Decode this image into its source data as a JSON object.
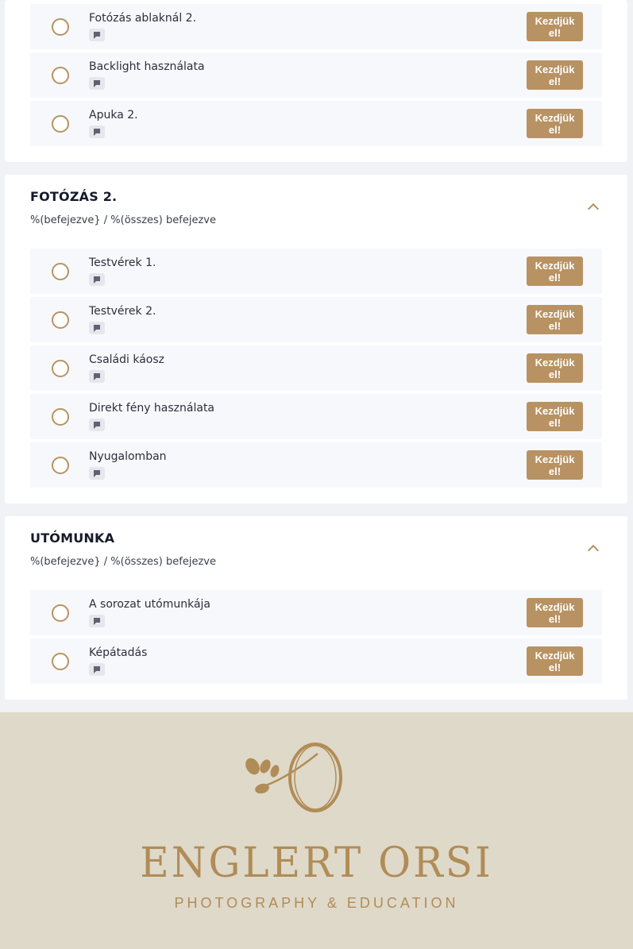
{
  "start_label": "Kezdjük el!",
  "progress_text": "%(befejezve} / %(összes) befejezve",
  "sections": [
    {
      "title": "",
      "lessons": [
        {
          "title": "Fotózás ablaknál 2."
        },
        {
          "title": "Backlight használata"
        },
        {
          "title": "Apuka 2."
        }
      ]
    },
    {
      "title": "FOTÓZÁS 2.",
      "lessons": [
        {
          "title": "Testvérek 1."
        },
        {
          "title": "Testvérek 2."
        },
        {
          "title": "Családi káosz"
        },
        {
          "title": "Direkt fény használata"
        },
        {
          "title": "Nyugalomban"
        }
      ]
    },
    {
      "title": "UTÓMUNKA",
      "lessons": [
        {
          "title": "A sorozat utómunkája"
        },
        {
          "title": "Képátadás"
        }
      ]
    }
  ],
  "footer": {
    "brand_name": "ENGLERT ORSI",
    "tagline": "PHOTOGRAPHY & EDUCATION",
    "logo_icon": "leaf-letter-o-logo"
  },
  "colors": {
    "accent": "#b89262",
    "footer_bg": "#dfd9c9",
    "brand": "#b08c57"
  }
}
